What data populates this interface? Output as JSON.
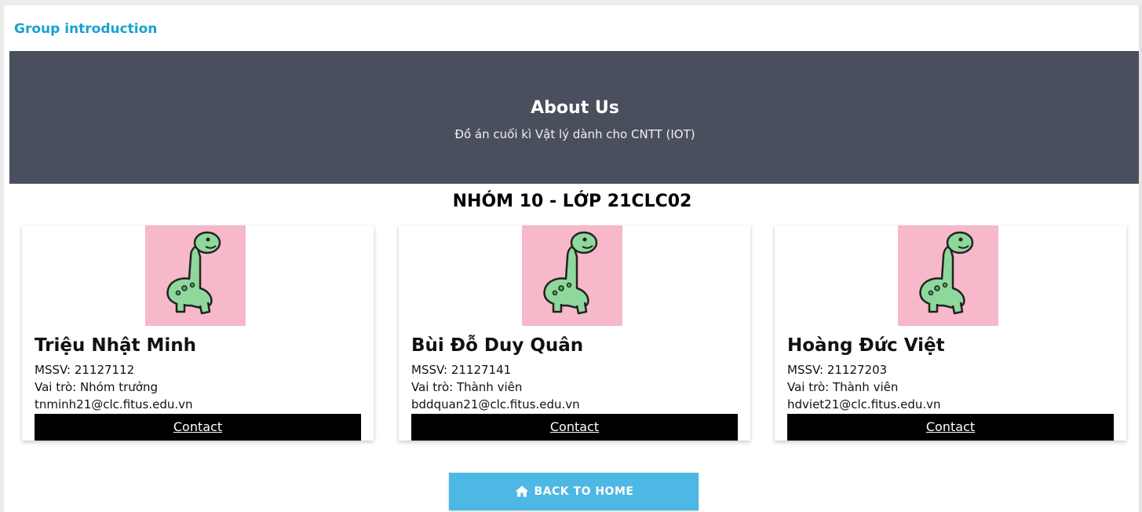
{
  "header": {
    "title": "Group introduction"
  },
  "hero": {
    "title": "About Us",
    "subtitle": "Đồ án cuối kì Vật lý dành cho CNTT (IOT)"
  },
  "group": {
    "title": "NHÓM 10 - LỚP 21CLC02"
  },
  "members": [
    {
      "name": "Triệu Nhật Minh",
      "mssv": "MSSV: 21127112",
      "role": "Vai trò: Nhóm trưởng",
      "email": "tnminh21@clc.fitus.edu.vn",
      "contact": "Contact",
      "avatar": "dinosaur-avatar"
    },
    {
      "name": "Bùi Đỗ Duy Quân",
      "mssv": "MSSV: 21127141",
      "role": "Vai trò: Thành viên",
      "email": "bddquan21@clc.fitus.edu.vn",
      "contact": "Contact",
      "avatar": "dinosaur-avatar"
    },
    {
      "name": "Hoàng Đức Việt",
      "mssv": "MSSV: 21127203",
      "role": "Vai trò: Thành viên",
      "email": "hdviet21@clc.fitus.edu.vn",
      "contact": "Contact",
      "avatar": "dinosaur-avatar"
    }
  ],
  "back_button": {
    "label": "BACK TO HOME",
    "icon": "home-icon"
  },
  "colors": {
    "accent": "#1ba1d1",
    "hero_bg": "#4a4f5e",
    "avatar_bg": "#f7b8c9",
    "button_bg": "#4db8e3",
    "contact_bg": "#000000"
  }
}
